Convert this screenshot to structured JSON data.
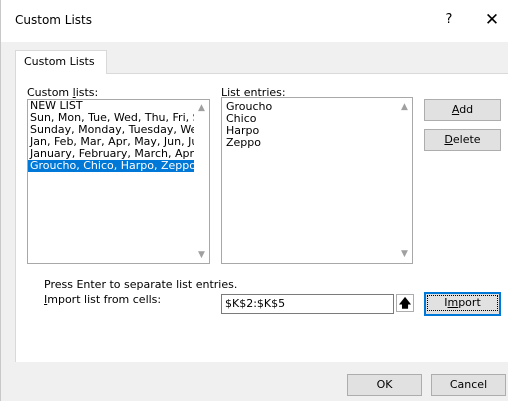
{
  "window": {
    "title": "Custom Lists",
    "help_glyph": "?",
    "close_glyph": "✕"
  },
  "tabs": [
    {
      "label": "Custom Lists"
    }
  ],
  "custom_lists": {
    "label": "Custom lists:",
    "items": [
      "NEW LIST",
      "Sun, Mon, Tue, Wed, Thu, Fri, Sat",
      "Sunday, Monday, Tuesday, Wednesday",
      "Jan, Feb, Mar, Apr, May, Jun, Jul",
      "January, February, March, April",
      "Groucho, Chico, Harpo, Zeppo"
    ],
    "selected_index": 5
  },
  "list_entries": {
    "label": "List entries:",
    "items": [
      "Groucho",
      "Chico",
      "Harpo",
      "Zeppo"
    ]
  },
  "buttons": {
    "add": "Add",
    "delete": "Delete",
    "import": "Import",
    "ok": "OK",
    "cancel": "Cancel"
  },
  "hint": "Press Enter to separate list entries.",
  "import_from": {
    "label": "Import list from cells:",
    "value": "$K$2:$K$5",
    "collapse_glyph": "🠅"
  },
  "colors": {
    "selection": "#0078d7",
    "dialog_bg": "#f0f0f0"
  }
}
